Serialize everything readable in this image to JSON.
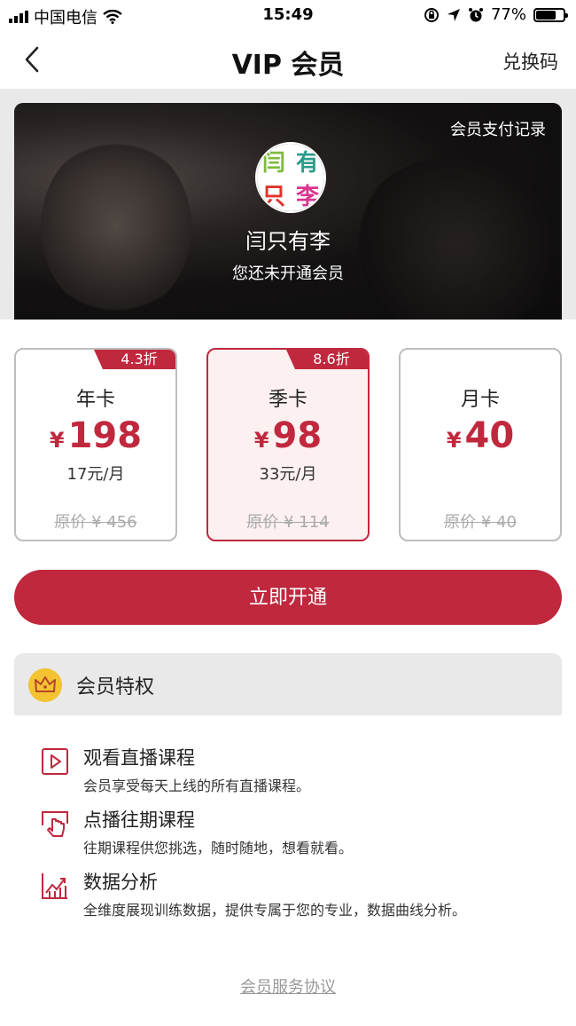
{
  "status_bar": {
    "carrier": "中国电信",
    "time": "15:49",
    "battery": "77%",
    "battery_level": 0.77
  },
  "nav": {
    "title": "VIP 会员",
    "right_label": "兑换码"
  },
  "profile": {
    "pay_record_link": "会员支付记录",
    "avatar_chars": [
      "闫",
      "有",
      "只",
      "李"
    ],
    "avatar_colors": [
      "#7dbb3c",
      "#2e9c8a",
      "#e0342b",
      "#d9358f"
    ],
    "name": "闫只有李",
    "status": "您还未开通会员"
  },
  "plans": [
    {
      "name": "年卡",
      "currency": "¥",
      "price": "198",
      "per_month": "17元/月",
      "original": "原价 ¥ 456",
      "discount": "4.3折",
      "selected": false
    },
    {
      "name": "季卡",
      "currency": "¥",
      "price": "98",
      "per_month": "33元/月",
      "original": "原价 ¥ 114",
      "discount": "8.6折",
      "selected": true
    },
    {
      "name": "月卡",
      "currency": "¥",
      "price": "40",
      "per_month": "",
      "original": "原价 ¥ 40",
      "discount": "",
      "selected": false
    }
  ],
  "cta_label": "立即开通",
  "privileges": {
    "title": "会员特权",
    "items": [
      {
        "icon": "play-icon",
        "title": "观看直播课程",
        "desc": "会员享受每天上线的所有直播课程。"
      },
      {
        "icon": "touch-icon",
        "title": "点播往期课程",
        "desc": "往期课程供您挑选，随时随地，想看就看。"
      },
      {
        "icon": "chart-icon",
        "title": "数据分析",
        "desc": "全维度展现训练数据，提供专属于您的专业，数据曲线分析。"
      }
    ]
  },
  "agreement": "会员服务协议",
  "colors": {
    "accent": "#c0283e",
    "crown": "#f3c332"
  }
}
